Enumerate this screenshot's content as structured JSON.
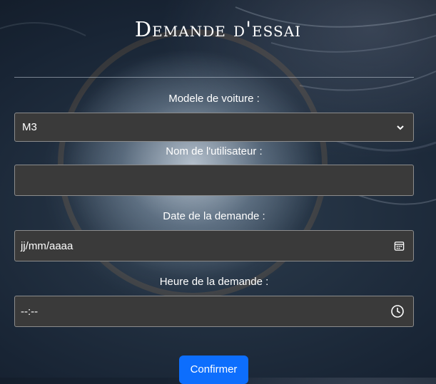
{
  "form": {
    "title": "Demande d'essai",
    "model_label": "Modele de voiture :",
    "model_value": "M3",
    "user_label": "Nom de l'utilisateur :",
    "user_value": "",
    "date_label": "Date de la demande :",
    "date_placeholder": "jj/mm/aaaa",
    "time_label": "Heure de la demande :",
    "time_placeholder": "--:--",
    "submit_label": "Confirmer"
  },
  "colors": {
    "field_bg": "#3a3a3a",
    "field_border": "#8c8c8c",
    "button": "#0d6efd"
  },
  "icons": {
    "model_select": "chevron-down-icon",
    "date": "calendar-icon",
    "time": "clock-icon"
  }
}
